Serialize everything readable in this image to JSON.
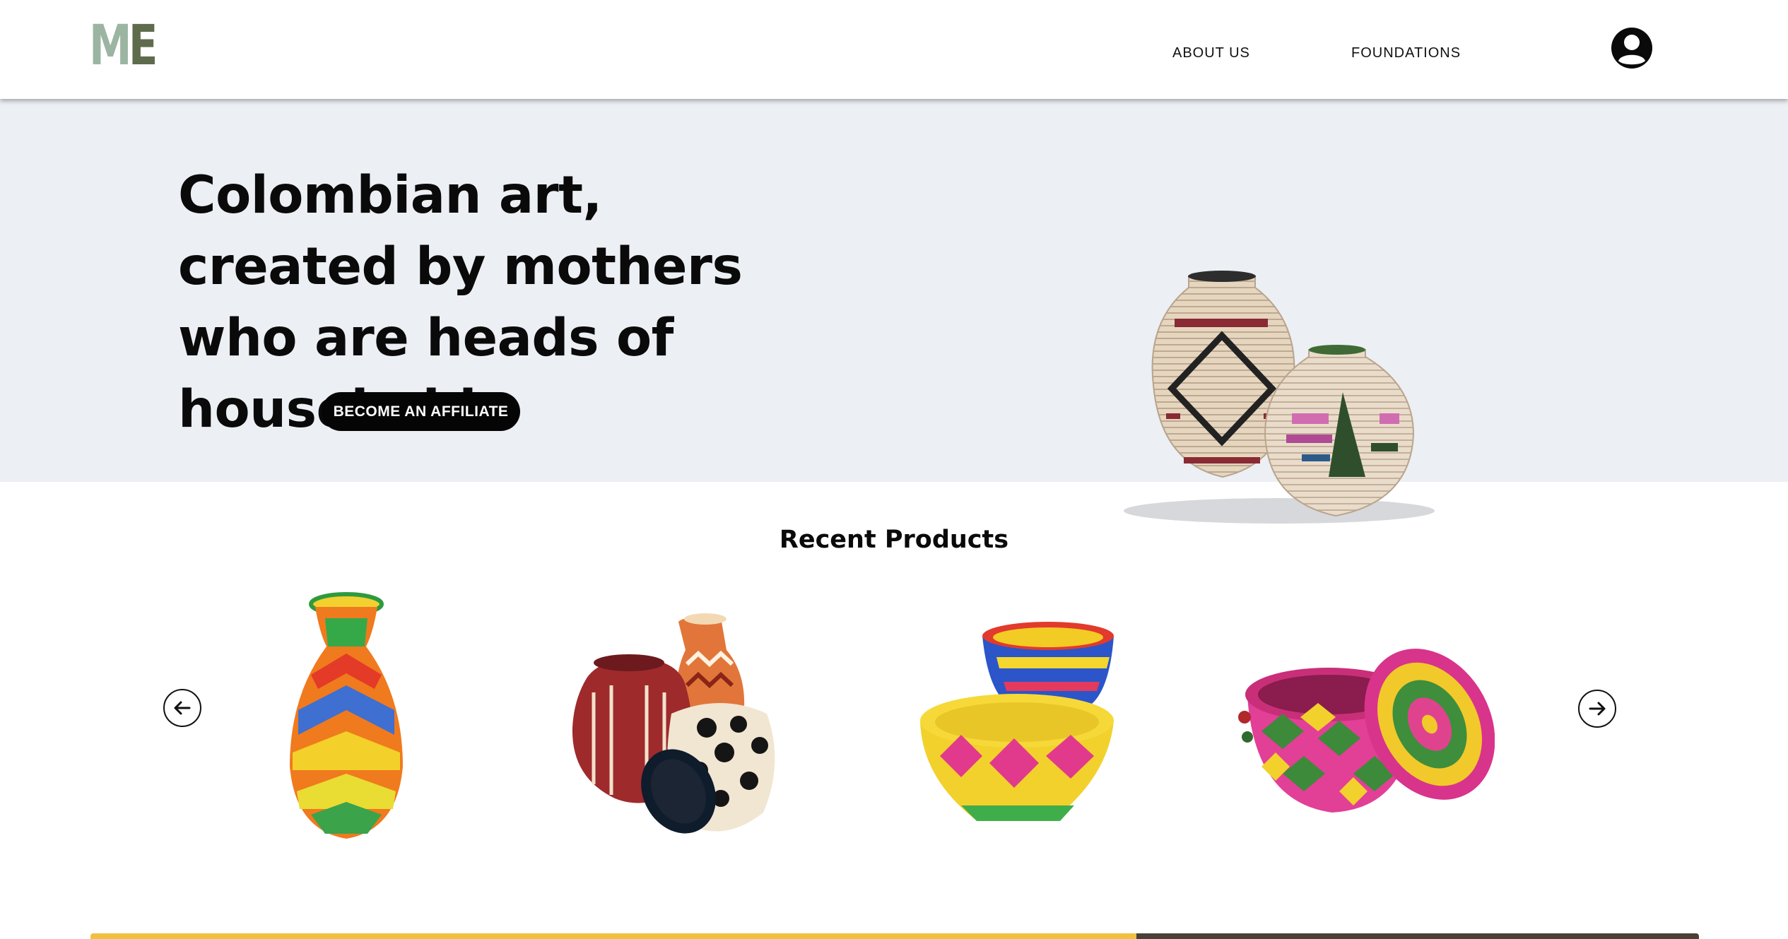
{
  "header": {
    "logo": {
      "m": "M",
      "e": "E"
    },
    "nav": [
      {
        "label": "ABOUT US"
      },
      {
        "label": "FOUNDATIONS"
      }
    ],
    "account_icon": "user-circle-icon"
  },
  "hero": {
    "title": "Colombian art, created by mothers who are heads of households",
    "cta_label": "BECOME AN AFFILIATE",
    "image": "woven-vases-image"
  },
  "products": {
    "title": "Recent Products",
    "prev_icon": "arrow-left-icon",
    "next_icon": "arrow-right-icon",
    "items": [
      {
        "image": "rainbow-woven-vase"
      },
      {
        "image": "wounaan-baskets-group"
      },
      {
        "image": "stacked-woven-bowls"
      },
      {
        "image": "lidded-woven-basket"
      }
    ]
  },
  "colors": {
    "logo_m": "#9bb5a2",
    "logo_e": "#5f6b4d",
    "hero_bg": "#eceff3",
    "cta_bg": "#050505",
    "strip_yellow": "#f1c040"
  }
}
